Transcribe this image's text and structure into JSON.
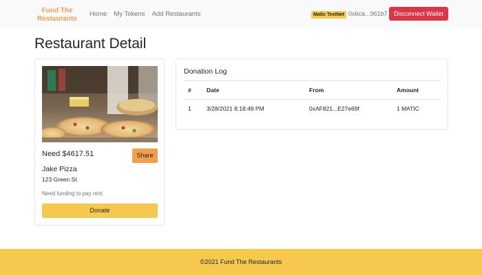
{
  "navbar": {
    "brand": "Fund The Restaurants",
    "links": [
      "Home",
      "My Tokens",
      "Add Restaurants"
    ],
    "network_badge": "Matic TestNet",
    "wallet_address": "0x6ca...961b7",
    "disconnect_label": "Disconnect Wallet"
  },
  "page": {
    "title": "Restaurant Detail"
  },
  "restaurant": {
    "need": "Need $4617.51",
    "share_label": "Share",
    "name": "Jake Pizza",
    "address": "123 Green St",
    "description": "Need funding to pay rent",
    "donate_label": "Donate"
  },
  "donation_log": {
    "title": "Donation Log",
    "columns": [
      "#",
      "Date",
      "From",
      "Amount"
    ],
    "rows": [
      {
        "num": "1",
        "date": "3/28/2021 8:18:49 PM",
        "from": "0xAF821...E27e69f",
        "amount": "1 MATIC"
      }
    ]
  },
  "footer": {
    "text": "©2021 Fund The Restaurants"
  },
  "colors": {
    "brand": "#f0a04b",
    "accent": "#f6c94e",
    "danger": "#dc3545",
    "navbar_bg": "#f8f9fa"
  }
}
